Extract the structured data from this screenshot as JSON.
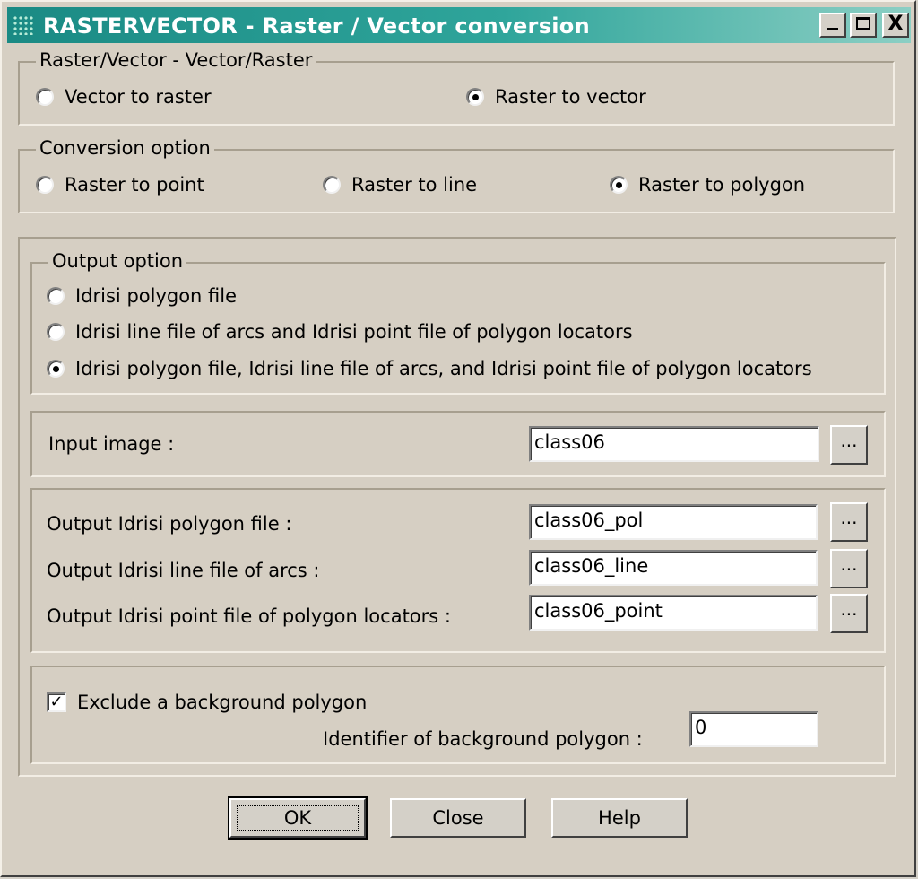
{
  "window": {
    "title": "RASTERVECTOR - Raster / Vector conversion",
    "controls": {
      "minimize": "_",
      "maximize": "□",
      "close": "X"
    }
  },
  "direction_group": {
    "label": "Raster/Vector - Vector/Raster",
    "options": [
      {
        "label": "Vector to raster",
        "checked": false
      },
      {
        "label": "Raster to vector",
        "checked": true
      }
    ]
  },
  "conversion_group": {
    "label": "Conversion option",
    "options": [
      {
        "label": "Raster to point",
        "checked": false
      },
      {
        "label": "Raster to line",
        "checked": false
      },
      {
        "label": "Raster to polygon",
        "checked": true
      }
    ]
  },
  "output_group": {
    "label": "Output option",
    "options": [
      {
        "label": "Idrisi polygon file",
        "checked": false
      },
      {
        "label": "Idrisi line file of arcs and Idrisi point file of polygon locators",
        "checked": false
      },
      {
        "label": "Idrisi polygon file, Idrisi line file of arcs, and Idrisi point file of polygon locators",
        "checked": true
      }
    ]
  },
  "input": {
    "label": "Input image :",
    "value": "class06",
    "browse_label": "..."
  },
  "outputs": [
    {
      "label": "Output Idrisi polygon file :",
      "value": "class06_pol",
      "browse_label": "..."
    },
    {
      "label": "Output Idrisi line file of arcs :",
      "value": "class06_line",
      "browse_label": "..."
    },
    {
      "label": "Output Idrisi point file of polygon locators :",
      "value": "class06_point",
      "browse_label": "..."
    }
  ],
  "background": {
    "checkbox_label": "Exclude a background polygon",
    "checked": true,
    "check_mark": "✓",
    "identifier_label": "Identifier of background polygon :",
    "identifier_value": "0"
  },
  "buttons": {
    "ok": "OK",
    "close": "Close",
    "help": "Help"
  }
}
